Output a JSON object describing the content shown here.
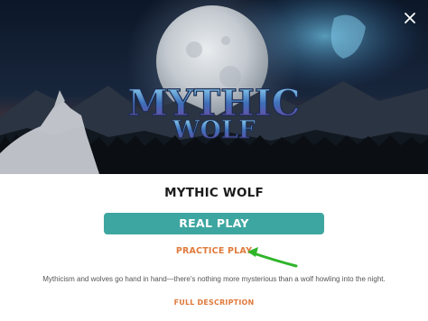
{
  "hero": {
    "logo_line1": "MYTHIC",
    "logo_line2": "WOLF"
  },
  "game": {
    "title": "MYTHIC WOLF",
    "real_play_label": "REAL PLAY",
    "practice_play_label": "PRACTICE PLAY",
    "description": "Mythicism and wolves go hand in hand—there's nothing more mysterious than a wolf howling into the night.",
    "full_description_label": "FULL DESCRIPTION"
  },
  "colors": {
    "accent_teal": "#3ea6a0",
    "link_orange": "#e07a3c",
    "annotation_arrow": "#2fb52a"
  },
  "icons": {
    "close": "close-icon",
    "arrow": "green-arrow-annotation"
  }
}
